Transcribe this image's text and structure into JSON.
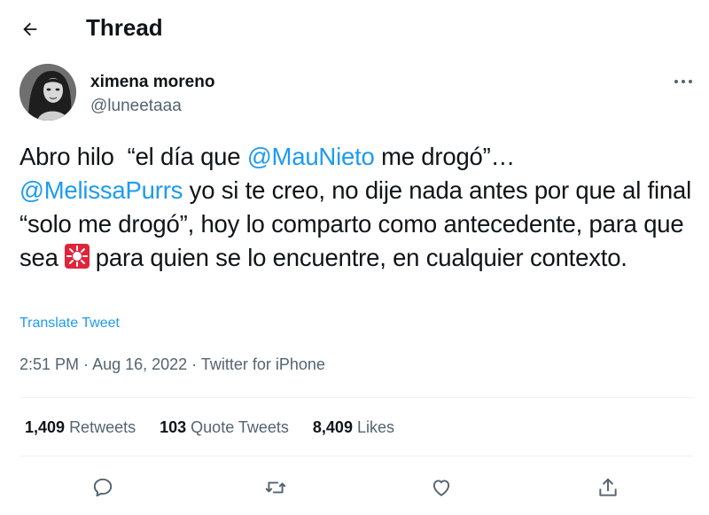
{
  "header": {
    "title": "Thread",
    "back_icon": "arrow-left-icon"
  },
  "author": {
    "name": "ximena moreno",
    "handle": "@luneetaaa",
    "more_icon": "more-horizontal-icon"
  },
  "tweet": {
    "line1_prefix": "Abro hilo  “el día que ",
    "mention1": "@MauNieto",
    "line1_suffix": " me drogó”…",
    "mention2": "@MelissaPurrs",
    "body_1": " yo si te creo, no dije nada antes por que al final “solo me drogó”, hoy lo comparto como antecedente, para que sea",
    "emoji": "rotating-light-icon",
    "body_2": "para quien se lo encuentre, en cualquier contexto."
  },
  "translate_label": "Translate Tweet",
  "meta": {
    "time": "2:51 PM",
    "date": "Aug 16, 2022",
    "source": "Twitter for iPhone",
    "sep": " · "
  },
  "stats": {
    "retweets_count": "1,409",
    "retweets_label": "Retweets",
    "quotes_count": "103",
    "quotes_label": "Quote Tweets",
    "likes_count": "8,409",
    "likes_label": "Likes"
  },
  "actions": [
    "reply-icon",
    "retweet-icon",
    "like-icon",
    "share-icon"
  ],
  "colors": {
    "accent": "#1d9bf0",
    "text": "#0f1419",
    "secondary": "#536471",
    "divider": "#eff3f4"
  }
}
